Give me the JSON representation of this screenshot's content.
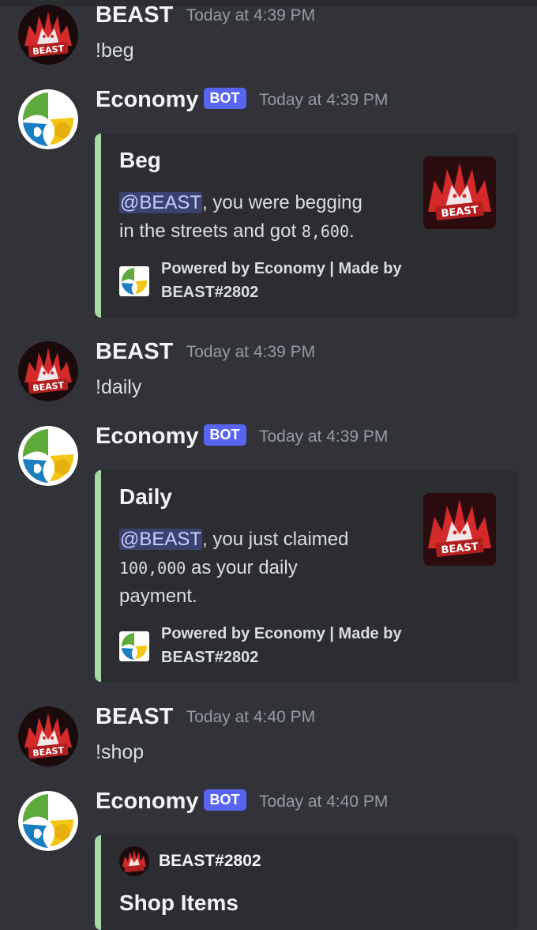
{
  "messages": [
    {
      "author": "BEAST",
      "timestamp": "Today at 4:39 PM",
      "text": "!beg"
    },
    {
      "author": "Economy",
      "badge": "BOT",
      "timestamp": "Today at 4:39 PM",
      "embed": {
        "title": "Beg",
        "mention": "@BEAST",
        "desc_line1": ", you were begging",
        "desc_line2_pre": "in the streets and got ",
        "amount": "8,600",
        "desc_line2_post": ".",
        "footer_line1": "Powered by Economy | Made by",
        "footer_line2": "BEAST#2802"
      }
    },
    {
      "author": "BEAST",
      "timestamp": "Today at 4:39 PM",
      "text": "!daily"
    },
    {
      "author": "Economy",
      "badge": "BOT",
      "timestamp": "Today at 4:39 PM",
      "embed": {
        "title": "Daily",
        "mention": "@BEAST",
        "desc_line1": ", you just claimed",
        "amount": "100,000",
        "desc_line2_post": " as your daily",
        "desc_line3": "payment.",
        "footer_line1": "Powered by Economy | Made by",
        "footer_line2": "BEAST#2802"
      }
    },
    {
      "author": "BEAST",
      "timestamp": "Today at 4:40 PM",
      "text": "!shop"
    },
    {
      "author": "Economy",
      "badge": "BOT",
      "timestamp": "Today at 4:40 PM",
      "embed": {
        "author_name": "BEAST#2802",
        "title": "Shop Items"
      }
    }
  ],
  "logo_text": "BEAST",
  "colors": {
    "background": "#313338",
    "embed_bg": "#2b2d31",
    "embed_border": "#a6d9a6",
    "bot_badge": "#5865f2",
    "mention_bg": "#3c4270"
  }
}
